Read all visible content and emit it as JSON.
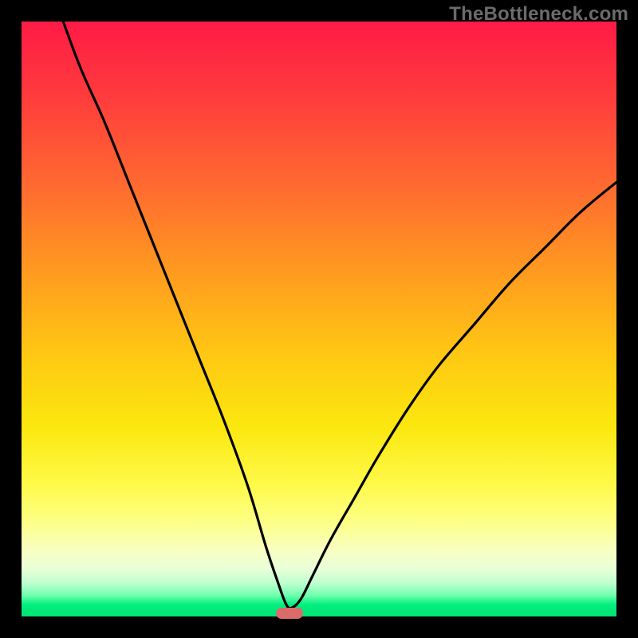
{
  "watermark": "TheBottleneck.com",
  "colors": {
    "marker": "#d96b6b",
    "curve": "#000000"
  },
  "chart_data": {
    "type": "line",
    "title": "",
    "xlabel": "",
    "ylabel": "",
    "xlim": [
      0,
      100
    ],
    "ylim": [
      0,
      100
    ],
    "grid": false,
    "legend": false,
    "annotations": [
      {
        "kind": "pill-marker",
        "x": 45,
        "y": 0.5,
        "color": "#d96b6b"
      }
    ],
    "series": [
      {
        "name": "bottleneck-curve",
        "color": "#000000",
        "x": [
          7,
          10,
          14,
          18,
          22,
          26,
          30,
          34,
          38,
          41,
          43,
          44.5,
          45.5,
          47,
          49,
          52,
          56,
          60,
          65,
          70,
          76,
          82,
          88,
          94,
          100
        ],
        "y": [
          100,
          92,
          83,
          73,
          63,
          53,
          43,
          33,
          22,
          12,
          6,
          2,
          1.5,
          3,
          7,
          13,
          20,
          27,
          35,
          42,
          49,
          56,
          62,
          68,
          73
        ]
      }
    ]
  }
}
